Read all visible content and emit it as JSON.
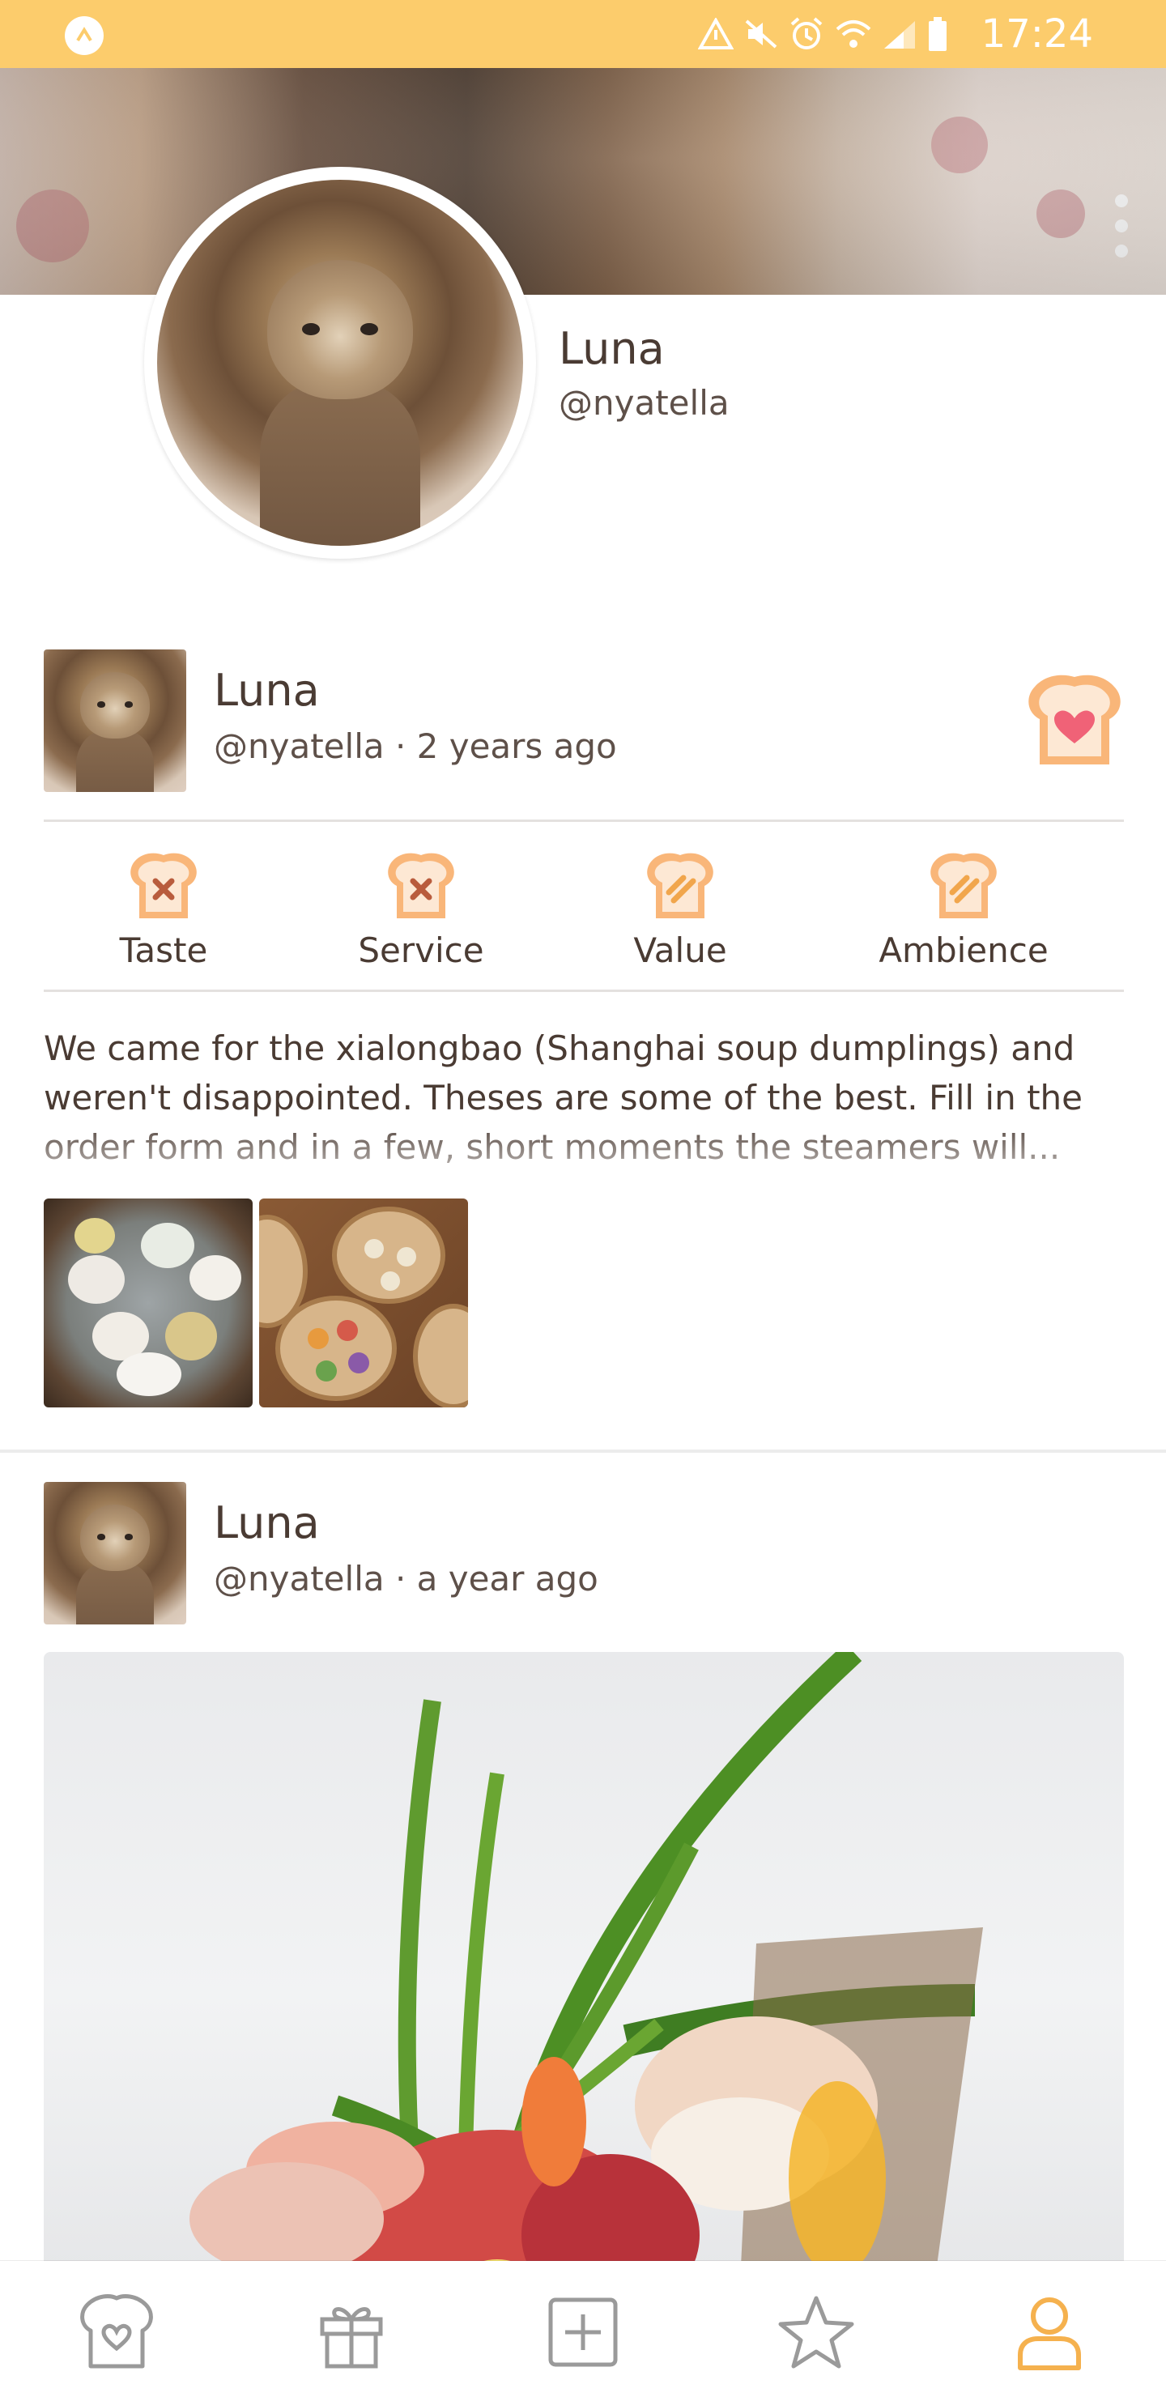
{
  "status_bar": {
    "time": "17:24"
  },
  "profile": {
    "name": "Luna",
    "handle": "@nyatella"
  },
  "posts": [
    {
      "author_name": "Luna",
      "meta": "@nyatella · 2 years ago",
      "ratings": [
        {
          "label": "Taste",
          "icon": "toast-x-icon"
        },
        {
          "label": "Service",
          "icon": "toast-x-icon"
        },
        {
          "label": "Value",
          "icon": "toast-stripes-icon"
        },
        {
          "label": "Ambience",
          "icon": "toast-stripes-icon"
        }
      ],
      "text": "We came for the xialongbao (Shanghai soup dumplings) and weren't disappointed. Theses are some of the best. Fill in the order form and in a few, short moments the steamers will..."
    },
    {
      "author_name": "Luna",
      "meta": "@nyatella · a year ago"
    }
  ],
  "bottom_nav": [
    "favorites-icon",
    "gift-icon",
    "add-icon",
    "star-icon",
    "profile-icon"
  ],
  "colors": {
    "accent": "#fccc6c",
    "toast": "#f9b679",
    "heart": "#f06277",
    "text": "#4a3b33"
  }
}
